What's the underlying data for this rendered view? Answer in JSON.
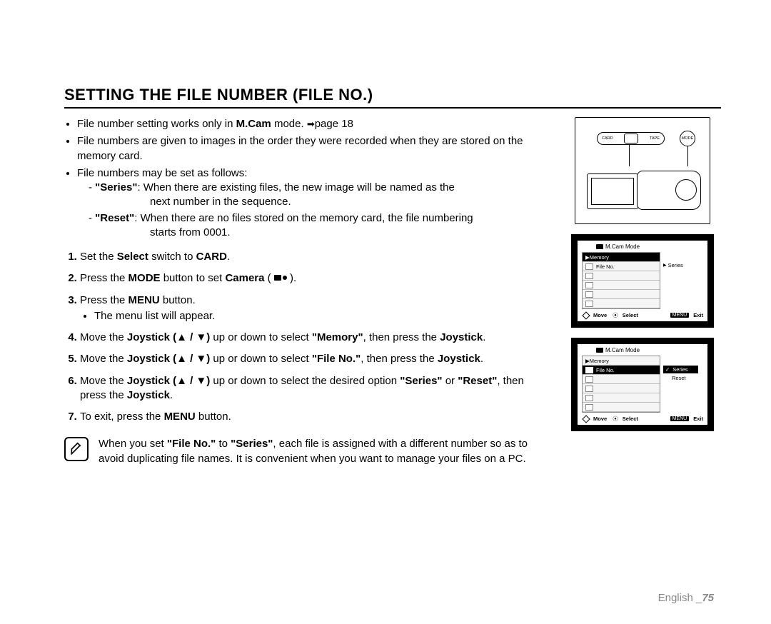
{
  "title": "SETTING THE FILE NUMBER (FILE NO.)",
  "bullets": {
    "b1a": "File number setting works only in ",
    "b1b": "M.Cam",
    "b1c": " mode. ",
    "b1d": "page 18",
    "b2": "File numbers are given to images in the order they were recorded when they are stored on the memory card.",
    "b3": "File numbers may be set as follows:",
    "sub1a": "\"Series\"",
    "sub1b": ": When there are existing files, the new image will be named as the",
    "sub1c": "next number in the sequence.",
    "sub2a": "\"Reset\"",
    "sub2b": ": When there are no files stored on the memory card, the file numbering",
    "sub2c": "starts from 0001."
  },
  "steps": {
    "s1a": "Set the ",
    "s1b": "Select",
    "s1c": " switch to ",
    "s1d": "CARD",
    "s1e": ".",
    "s2a": "Press the ",
    "s2b": "MODE",
    "s2c": " button to set ",
    "s2d": "Camera",
    "s2e": " ( ",
    "s2f": " ).",
    "s3a": "Press the ",
    "s3b": "MENU",
    "s3c": " button.",
    "s3sub": "The menu list will appear.",
    "s4a": "Move the ",
    "s4b": "Joystick (▲ / ▼)",
    "s4c": " up or down to select ",
    "s4d": "\"Memory\"",
    "s4e": ", then press the ",
    "s4f": "Joystick",
    "s4g": ".",
    "s5a": "Move the ",
    "s5b": "Joystick (▲ / ▼)",
    "s5c": " up or down to select ",
    "s5d": "\"File No.\"",
    "s5e": ", then press the ",
    "s5f": "Joystick",
    "s5g": ".",
    "s6a": "Move the ",
    "s6b": "Joystick (▲ / ▼)",
    "s6c": " up or down to select the desired option ",
    "s6d": "\"Series\"",
    "s6e": " or ",
    "s6f": "\"Reset\"",
    "s6g": ", then press the ",
    "s6h": "Joystick",
    "s6i": ".",
    "s7a": "To exit, press the ",
    "s7b": "MENU",
    "s7c": " button."
  },
  "noteA": "When you set ",
  "noteB": "\"File No.\"",
  "noteC": " to ",
  "noteD": "\"Series\"",
  "noteE": ", each file is assigned with a different number so as to avoid duplicating file names. It is convenient when you want to manage your files on a PC.",
  "diagram": {
    "card": "CARD",
    "tape": "TAPE",
    "mode": "MODE"
  },
  "lcd1": {
    "header": "M.Cam Mode",
    "row_memory": "Memory",
    "row_fileno": "File No.",
    "side": "Series",
    "move": "Move",
    "select": "Select",
    "menu": "MENU",
    "exit": "Exit"
  },
  "lcd2": {
    "header": "M.Cam Mode",
    "row_memory": "Memory",
    "row_fileno": "File No.",
    "opt1": "Series",
    "opt2": "Reset",
    "move": "Move",
    "select": "Select",
    "menu": "MENU",
    "exit": "Exit"
  },
  "footer": {
    "lang": "English _",
    "page": "75"
  }
}
